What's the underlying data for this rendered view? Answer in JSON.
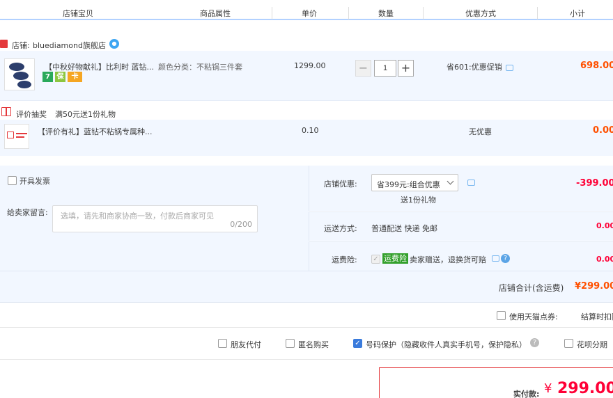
{
  "columns": {
    "shop_item": "店铺宝贝",
    "attributes": "商品属性",
    "unit_price": "单价",
    "quantity": "数量",
    "discount": "优惠方式",
    "subtotal": "小计"
  },
  "shop": {
    "label": "店铺:",
    "name": "bluediamond旗舰店",
    "badge": "天猫"
  },
  "item1": {
    "title": "【中秋好物献礼】比利时 蓝钻...",
    "attr": "颜色分类：不粘锅三件套",
    "price": "1299.00",
    "qty": "1",
    "discount": "省601:优惠促销",
    "subtotal": "698.00",
    "tags": [
      "7",
      "保",
      "卡"
    ]
  },
  "promo": {
    "label": "评价抽奖",
    "text": "满50元送1份礼物"
  },
  "item2": {
    "title": "【评价有礼】蓝钻不粘锅专属种...",
    "price": "0.10",
    "discount": "无优惠",
    "subtotal": "0.00"
  },
  "invoice": {
    "label": "开具发票"
  },
  "message": {
    "label": "给卖家留言:",
    "placeholder": "选填，请先和商家协商一致，付款后商家可见",
    "counter": "0/200"
  },
  "shop_discount": {
    "label": "店铺优惠:",
    "selected": "省399元:组合优惠",
    "note": "送1份礼物",
    "amount": "-399.00"
  },
  "shipping": {
    "label": "运送方式:",
    "text": "普通配送 快递 免邮",
    "amount": "0.00"
  },
  "insurance": {
    "label": "运费险:",
    "badge": "运费险",
    "text": "卖家赠送，退换货可赔",
    "amount": "0.00"
  },
  "shop_total": {
    "label": "店铺合计(含运费)",
    "amount": "¥299.00"
  },
  "points": {
    "label": "使用天猫点券:",
    "text": "结算时扣除"
  },
  "options": {
    "friend_pay": "朋友代付",
    "anonymous": "匿名购买",
    "number_protect": "号码保护（隐藏收件人真实手机号，保护隐私）",
    "huabei": "花呗分期"
  },
  "pay": {
    "label": "实付款:",
    "currency": "¥",
    "amount": "299.00"
  },
  "colors": {
    "accent": "#ff5000",
    "pay_red": "#ff0036",
    "header_line": "#b2d1ff",
    "row_bg": "#f2f7ff",
    "insurance_green": "#33a02c"
  }
}
